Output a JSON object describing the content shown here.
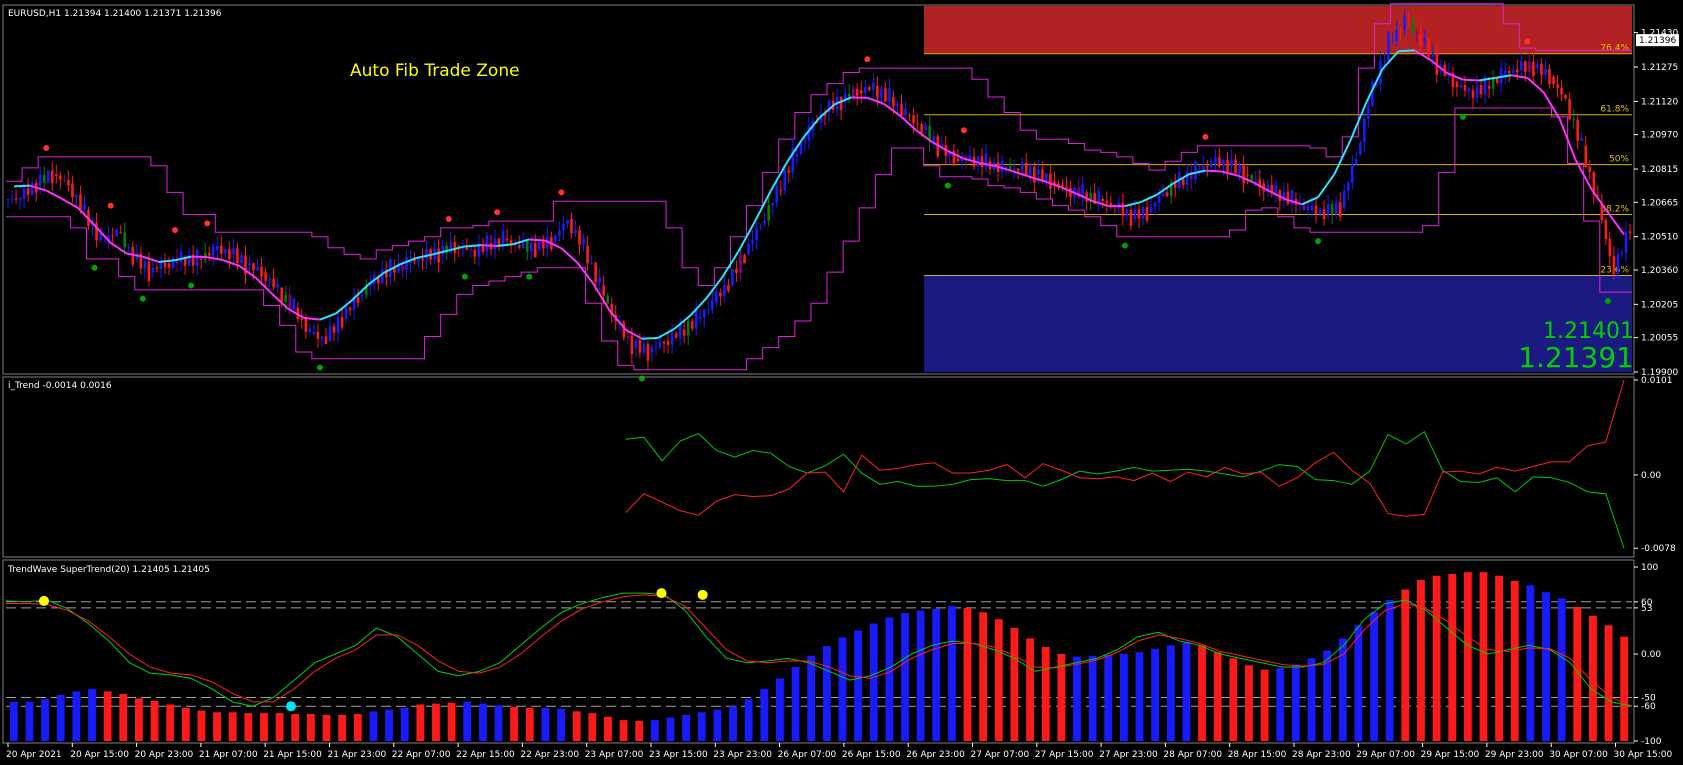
{
  "chart_data": [
    {
      "type": "candlestick",
      "symbol_header": "EURUSD,H1  1.21394 1.21400 1.21371 1.21396",
      "title": "Auto Fib Trade Zone",
      "current_price_label": "1.21396",
      "ylim": [
        1.199,
        1.2155
      ],
      "y_ticks": [
        "1.21430",
        "1.21275",
        "1.21120",
        "1.20970",
        "1.20815",
        "1.20665",
        "1.20510",
        "1.20360",
        "1.20205",
        "1.20055",
        "1.19900"
      ],
      "y_tick_values": [
        1.2143,
        1.21275,
        1.2112,
        1.2097,
        1.20815,
        1.20665,
        1.2051,
        1.2036,
        1.20205,
        1.20055,
        1.199
      ],
      "fib_levels": [
        {
          "label": "76.4%",
          "price": 1.21335
        },
        {
          "label": "61.8%",
          "price": 1.2106
        },
        {
          "label": "50%",
          "price": 1.20835
        },
        {
          "label": "38.2%",
          "price": 1.2061
        },
        {
          "label": "23.6%",
          "price": 1.20335
        }
      ],
      "zones": {
        "upper_top": 1.2155,
        "upper_bottom": 1.21335,
        "lower_top": 1.20335,
        "lower_bottom": 1.199
      },
      "bid_display": "1.21401",
      "ask_display": "1.21391",
      "close_series": [
        1.2068,
        1.2074,
        1.2079,
        1.2075,
        1.2063,
        1.2049,
        1.2053,
        1.2041,
        1.2035,
        1.2039,
        1.2042,
        1.2041,
        1.2045,
        1.2043,
        1.2038,
        1.2035,
        1.2028,
        1.2019,
        1.2007,
        1.2004,
        1.2014,
        1.2024,
        1.2033,
        1.2037,
        1.2039,
        1.2041,
        1.2043,
        1.2047,
        1.2045,
        1.2048,
        1.205,
        1.2046,
        1.2045,
        1.2049,
        1.2059,
        1.2047,
        1.2029,
        1.2012,
        1.2001,
        1.1999,
        1.2004,
        1.2009,
        1.2014,
        1.2021,
        1.2029,
        1.2043,
        1.2057,
        1.2072,
        1.2087,
        1.2099,
        1.2107,
        1.2112,
        1.2117,
        1.2119,
        1.2114,
        1.2106,
        1.2099,
        1.2091,
        1.2086,
        1.2087,
        1.2085,
        1.2082,
        1.2081,
        1.2079,
        1.2076,
        1.2073,
        1.2071,
        1.2068,
        1.2064,
        1.2059,
        1.2062,
        1.2071,
        1.2077,
        1.2081,
        1.2084,
        1.2083,
        1.2079,
        1.2075,
        1.2072,
        1.2068,
        1.2063,
        1.2061,
        1.2064,
        1.2088,
        1.2119,
        1.2139,
        1.2148,
        1.2139,
        1.2128,
        1.2121,
        1.2117,
        1.2119,
        1.2124,
        1.2126,
        1.2127,
        1.2123,
        1.2113,
        1.2092,
        1.2066,
        1.2034,
        1.2056
      ],
      "supertrend_points": [
        [
          0,
          1.2062
        ],
        [
          4,
          1.2072
        ],
        [
          10,
          1.2054
        ],
        [
          16,
          1.2041
        ],
        [
          21,
          1.2021
        ],
        [
          24,
          1.2011
        ],
        [
          29,
          1.2034
        ],
        [
          35,
          1.2043
        ],
        [
          40,
          1.2009
        ],
        [
          45,
          1.2024
        ],
        [
          49,
          1.2075
        ],
        [
          54,
          1.2108
        ],
        [
          57,
          1.2123
        ],
        [
          61,
          1.2099
        ],
        [
          64,
          1.2082
        ],
        [
          68,
          1.2082
        ],
        [
          72,
          1.2071
        ],
        [
          75,
          1.2084
        ],
        [
          78,
          1.2083
        ],
        [
          83,
          1.2065
        ],
        [
          86,
          1.2093
        ],
        [
          89,
          1.215
        ],
        [
          92,
          1.2142
        ],
        [
          96,
          1.2131
        ],
        [
          98,
          1.2124
        ],
        [
          100,
          1.2098
        ],
        [
          103,
          1.2066
        ]
      ],
      "x_ticks": [
        "20 Apr 2021",
        "20 Apr 15:00",
        "20 Apr 23:00",
        "21 Apr 07:00",
        "21 Apr 15:00",
        "21 Apr 23:00",
        "22 Apr 07:00",
        "22 Apr 15:00",
        "22 Apr 23:00",
        "23 Apr 07:00",
        "23 Apr 15:00",
        "23 Apr 23:00",
        "26 Apr 07:00",
        "26 Apr 15:00",
        "26 Apr 23:00",
        "27 Apr 07:00",
        "27 Apr 15:00",
        "27 Apr 23:00",
        "28 Apr 07:00",
        "28 Apr 15:00",
        "28 Apr 23:00",
        "29 Apr 07:00",
        "29 Apr 15:00",
        "29 Apr 23:00",
        "30 Apr 07:00",
        "30 Apr 15:00"
      ]
    },
    {
      "type": "line",
      "header": "i_Trend -0.0014 0.0016",
      "ylim": [
        -0.0082,
        0.0101
      ],
      "y_ticks": [
        "0.0101",
        "0.00",
        "-0.0078"
      ],
      "y_tick_values": [
        0.0101,
        0,
        -0.0078
      ],
      "series": [
        {
          "color": "#00c800",
          "x_start": 38,
          "values": [
            0.0038,
            0.004,
            0.0015,
            0.0036,
            0.0044,
            0.0026,
            0.0019,
            0.0026,
            0.0023,
            0.0009,
            0.0002,
            0.001,
            0.0022,
            0.0002,
            -0.001,
            -0.0007,
            -0.0012,
            -0.0012,
            -0.001,
            -0.0005,
            -0.0004,
            -0.0006,
            -0.0006,
            -0.0012,
            -0.0005,
            0.0004,
            0.0001,
            0.0004,
            0.0008,
            0.0004,
            0.0005,
            0.0006,
            0.0004,
            0.0001,
            -0.0002,
            0.0004,
            0.0011,
            0.0009,
            -0.0005,
            -0.0006,
            -0.001,
            0.0004,
            0.0043,
            0.0033,
            0.0046,
            0.0005,
            -0.0007,
            -0.0008,
            -0.0003,
            -0.0018,
            -0.0002,
            -0.0003,
            -0.0008,
            -0.0018,
            -0.002,
            -0.0078
          ]
        },
        {
          "color": "#ff2020",
          "x_start": 38,
          "values": [
            -0.004,
            -0.002,
            -0.0029,
            -0.0038,
            -0.0043,
            -0.0028,
            -0.0021,
            -0.0023,
            -0.0022,
            -0.0015,
            0.0002,
            0.0003,
            -0.0018,
            0.0021,
            0.0005,
            0.0007,
            0.0011,
            0.0013,
            0.0002,
            0.0002,
            0.0005,
            0.0011,
            -0.0003,
            0.0012,
            0.0005,
            -0.0003,
            -0.0004,
            -0.0002,
            -0.0006,
            0.0002,
            -0.0007,
            0.0003,
            -0.0002,
            0.0008,
            0.0001,
            0.0003,
            -0.0012,
            -0.0003,
            0.0013,
            0.0024,
            0.0005,
            -0.0009,
            -0.0041,
            -0.0044,
            -0.0042,
            0.0003,
            0.0004,
            0.0001,
            0.0008,
            0.0004,
            0.0009,
            0.0014,
            0.0014,
            0.0031,
            0.0035,
            0.0101
          ]
        }
      ]
    },
    {
      "type": "bar",
      "header": "TrendWave  SuperTrend(20) 1.21405 1.21405",
      "ylim": [
        -100,
        100
      ],
      "y_ticks": [
        "100",
        "60",
        "53",
        "0.00",
        "-50",
        "-60",
        "-100"
      ],
      "y_tick_values": [
        100,
        60,
        53,
        0,
        -50,
        -60,
        -100
      ],
      "levels": [
        60,
        53,
        -50,
        -60
      ],
      "histogram": [
        -55,
        -55,
        -52,
        -47,
        -43,
        -40,
        -43,
        -46,
        -51,
        -54,
        -58,
        -62,
        -65,
        -67,
        -67,
        -68,
        -68,
        -68,
        -69,
        -69,
        -70,
        -70,
        -69,
        -66,
        -64,
        -62,
        -58,
        -57,
        -56,
        -55,
        -57,
        -59,
        -61,
        -62,
        -62,
        -63,
        -66,
        -68,
        -72,
        -76,
        -77,
        -76,
        -73,
        -70,
        -67,
        -64,
        -60,
        -52,
        -40,
        -28,
        -15,
        -2,
        9,
        19,
        27,
        35,
        42,
        47,
        50,
        52,
        55,
        53,
        48,
        40,
        30,
        18,
        8,
        0,
        -3,
        -2,
        -1,
        0,
        2,
        6,
        10,
        14,
        10,
        2,
        -5,
        -13,
        -18,
        -16,
        -12,
        -5,
        4,
        18,
        33,
        48,
        62,
        74,
        85,
        90,
        92,
        94,
        94,
        90,
        84,
        79,
        71,
        64,
        54,
        44,
        33,
        20
      ],
      "hist_positive_bias": [
        1,
        1,
        1,
        1,
        1,
        1,
        0,
        0,
        0,
        0,
        0,
        0,
        0,
        0,
        0,
        0,
        0,
        0,
        0,
        0,
        0,
        0,
        0,
        1,
        1,
        1,
        0,
        0,
        0,
        1,
        1,
        1,
        0,
        0,
        1,
        1,
        0,
        0,
        0,
        0,
        0,
        1,
        1,
        1,
        1,
        1,
        1,
        1,
        1,
        1,
        1,
        1,
        1,
        1,
        1,
        1,
        1,
        1,
        1,
        1,
        1,
        0,
        0,
        0,
        0,
        0,
        0,
        0,
        1,
        1,
        1,
        1,
        1,
        1,
        1,
        1,
        0,
        0,
        0,
        0,
        0,
        1,
        1,
        1,
        1,
        1,
        1,
        1,
        1,
        0,
        0,
        0,
        0,
        0,
        0,
        0,
        0,
        1,
        1,
        1,
        0,
        0,
        0,
        0
      ],
      "fast_line": [
        61,
        60,
        62,
        52,
        35,
        15,
        -10,
        -22,
        -24,
        -28,
        -40,
        -55,
        -60,
        -50,
        -30,
        -10,
        0,
        10,
        30,
        20,
        0,
        -20,
        -25,
        -20,
        -10,
        10,
        30,
        48,
        58,
        65,
        70,
        70,
        68,
        50,
        20,
        -5,
        -10,
        -8,
        -5,
        -10,
        -20,
        -30,
        -25,
        -15,
        0,
        10,
        15,
        12,
        5,
        -5,
        -20,
        -15,
        -10,
        -5,
        5,
        20,
        25,
        15,
        10,
        0,
        -5,
        -10,
        -15,
        -15,
        -10,
        10,
        40,
        58,
        62,
        50,
        30,
        10,
        0,
        5,
        10,
        5,
        -10,
        -40,
        -55,
        -60
      ],
      "slow_line": [
        58,
        58,
        57,
        50,
        38,
        20,
        0,
        -15,
        -22,
        -24,
        -32,
        -45,
        -55,
        -55,
        -40,
        -20,
        -5,
        5,
        22,
        22,
        10,
        -8,
        -20,
        -22,
        -15,
        0,
        20,
        38,
        52,
        60,
        66,
        68,
        66,
        55,
        30,
        5,
        -8,
        -10,
        -8,
        -8,
        -15,
        -25,
        -28,
        -20,
        -5,
        5,
        12,
        12,
        8,
        -2,
        -15,
        -16,
        -12,
        -7,
        2,
        15,
        22,
        18,
        12,
        3,
        -2,
        -7,
        -12,
        -14,
        -12,
        0,
        28,
        50,
        58,
        52,
        38,
        20,
        5,
        3,
        7,
        6,
        -5,
        -30,
        -50,
        -60
      ],
      "signal_dots": [
        {
          "index": 0,
          "value": 61,
          "color": "#ffff00"
        },
        {
          "index": 12,
          "value": -60,
          "color": "#00e5ff"
        },
        {
          "index": 30,
          "value": 70,
          "color": "#ffff00"
        },
        {
          "index": 32,
          "value": 68,
          "color": "#ffff00"
        }
      ]
    }
  ]
}
